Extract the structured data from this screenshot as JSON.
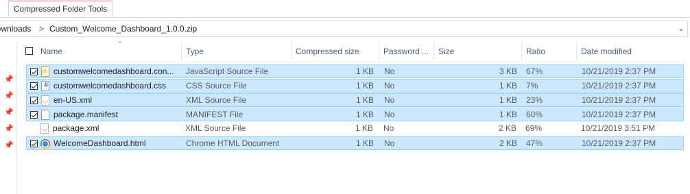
{
  "ribbon": {
    "context_tab": "Compressed Folder Tools"
  },
  "address": {
    "crumbs": [
      "Downloads",
      "Custom_Welcome_Dashboard_1.0.0.zip"
    ],
    "separator": ">",
    "dropdown_icon": "chevron-down-icon"
  },
  "columns": {
    "name": "Name",
    "type": "Type",
    "compressed_size": "Compressed size",
    "password": "Password ...",
    "size": "Size",
    "ratio": "Ratio",
    "date": "Date modified"
  },
  "rows": [
    {
      "name": "customwelcomedashboard.con...",
      "type": "JavaScript Source File",
      "compressed_size": "1 KB",
      "password": "No",
      "size": "3 KB",
      "ratio": "67%",
      "date": "10/21/2019 2:37 PM",
      "icon": "js-file-icon",
      "checked": true
    },
    {
      "name": "customwelcomedashboard.css",
      "type": "CSS Source File",
      "compressed_size": "1 KB",
      "password": "No",
      "size": "1 KB",
      "ratio": "7%",
      "date": "10/21/2019 2:37 PM",
      "icon": "css-file-icon",
      "checked": true
    },
    {
      "name": "en-US.xml",
      "type": "XML Source File",
      "compressed_size": "1 KB",
      "password": "No",
      "size": "1 KB",
      "ratio": "23%",
      "date": "10/21/2019 2:37 PM",
      "icon": "xml-file-icon",
      "checked": true
    },
    {
      "name": "package.manifest",
      "type": "MANIFEST File",
      "compressed_size": "1 KB",
      "password": "No",
      "size": "1 KB",
      "ratio": "60%",
      "date": "10/21/2019 2:37 PM",
      "icon": "file-icon",
      "checked": true
    },
    {
      "name": "package.xml",
      "type": "XML Source File",
      "compressed_size": "1 KB",
      "password": "No",
      "size": "2 KB",
      "ratio": "69%",
      "date": "10/21/2019 3:51 PM",
      "icon": "xml-file-icon",
      "checked": false
    },
    {
      "name": "WelcomeDashboard.html",
      "type": "Chrome HTML Document",
      "compressed_size": "1 KB",
      "password": "No",
      "size": "2 KB",
      "ratio": "47%",
      "date": "10/21/2019 2:37 PM",
      "icon": "chrome-icon",
      "checked": true
    }
  ],
  "selection": {
    "highlight": "#cce8ff",
    "border": "#99d1ff"
  }
}
